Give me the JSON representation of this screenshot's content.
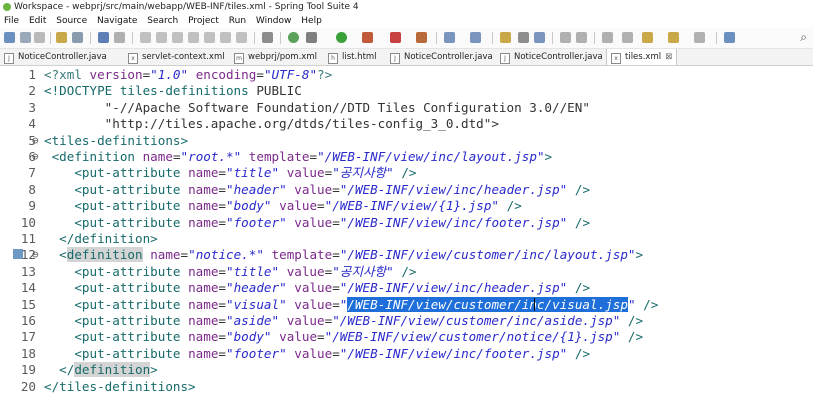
{
  "window": {
    "title": "Workspace - webprj/src/main/webapp/WEB-INF/tiles.xml - Spring Tool Suite 4"
  },
  "menu": [
    "File",
    "Edit",
    "Source",
    "Navigate",
    "Search",
    "Project",
    "Run",
    "Window",
    "Help"
  ],
  "tabs": [
    {
      "label": "NoticeController.java",
      "active": false
    },
    {
      "label": "servlet-context.xml",
      "active": false
    },
    {
      "label": "webprj/pom.xml",
      "active": false
    },
    {
      "label": "list.html",
      "active": false
    },
    {
      "label": "NoticeController.java",
      "active": false
    },
    {
      "label": "NoticeController.java",
      "active": false
    },
    {
      "label": "tiles.xml",
      "active": true
    }
  ],
  "editor": {
    "lines": [
      {
        "n": "1",
        "fold": "",
        "segs": [
          [
            "pi",
            "<?xml "
          ],
          [
            "attr",
            "version"
          ],
          [
            "plain",
            "="
          ],
          [
            "val",
            "\"1.0\""
          ],
          [
            "plain",
            " "
          ],
          [
            "attr",
            "encoding"
          ],
          [
            "plain",
            "="
          ],
          [
            "val",
            "\"UTF-8\""
          ],
          [
            "pi",
            "?>"
          ]
        ]
      },
      {
        "n": "2",
        "fold": "",
        "segs": [
          [
            "tag",
            "<!DOCTYPE "
          ],
          [
            "kw",
            "tiles-definitions "
          ],
          [
            "doc",
            "PUBLIC"
          ]
        ]
      },
      {
        "n": "3",
        "fold": "",
        "segs": [
          [
            "doc",
            "        \"-//Apache Software Foundation//DTD Tiles Configuration 3.0//EN\""
          ]
        ]
      },
      {
        "n": "4",
        "fold": "",
        "segs": [
          [
            "doc",
            "        \"http://tiles.apache.org/dtds/tiles-config_3_0.dtd\">"
          ]
        ]
      },
      {
        "n": "5",
        "fold": "⊖",
        "segs": [
          [
            "tag",
            "<tiles-definitions>"
          ]
        ]
      },
      {
        "n": "6",
        "fold": "⊖",
        "segs": [
          [
            "plain",
            " "
          ],
          [
            "tag",
            "<definition "
          ],
          [
            "attr",
            "name"
          ],
          [
            "plain",
            "="
          ],
          [
            "val",
            "\"root.*\""
          ],
          [
            "plain",
            " "
          ],
          [
            "attr",
            "template"
          ],
          [
            "plain",
            "="
          ],
          [
            "val",
            "\"/WEB-INF/view/inc/layout.jsp\""
          ],
          [
            "tag",
            ">"
          ]
        ]
      },
      {
        "n": "7",
        "fold": "",
        "segs": [
          [
            "plain",
            "    "
          ],
          [
            "tag",
            "<put-attribute "
          ],
          [
            "attr",
            "name"
          ],
          [
            "plain",
            "="
          ],
          [
            "val",
            "\"title\""
          ],
          [
            "plain",
            " "
          ],
          [
            "attr",
            "value"
          ],
          [
            "plain",
            "="
          ],
          [
            "val",
            "\"공지사항\""
          ],
          [
            "plain",
            " "
          ],
          [
            "tag",
            "/>"
          ]
        ]
      },
      {
        "n": "8",
        "fold": "",
        "segs": [
          [
            "plain",
            "    "
          ],
          [
            "tag",
            "<put-attribute "
          ],
          [
            "attr",
            "name"
          ],
          [
            "plain",
            "="
          ],
          [
            "val",
            "\"header\""
          ],
          [
            "plain",
            " "
          ],
          [
            "attr",
            "value"
          ],
          [
            "plain",
            "="
          ],
          [
            "val",
            "\"/WEB-INF/view/inc/header.jsp\""
          ],
          [
            "plain",
            " "
          ],
          [
            "tag",
            "/>"
          ]
        ]
      },
      {
        "n": "9",
        "fold": "",
        "segs": [
          [
            "plain",
            "    "
          ],
          [
            "tag",
            "<put-attribute "
          ],
          [
            "attr",
            "name"
          ],
          [
            "plain",
            "="
          ],
          [
            "val",
            "\"body\""
          ],
          [
            "plain",
            " "
          ],
          [
            "attr",
            "value"
          ],
          [
            "plain",
            "="
          ],
          [
            "val",
            "\"/WEB-INF/view/{1}.jsp\""
          ],
          [
            "plain",
            " "
          ],
          [
            "tag",
            "/>"
          ]
        ]
      },
      {
        "n": "10",
        "fold": "",
        "segs": [
          [
            "plain",
            "    "
          ],
          [
            "tag",
            "<put-attribute "
          ],
          [
            "attr",
            "name"
          ],
          [
            "plain",
            "="
          ],
          [
            "val",
            "\"footer\""
          ],
          [
            "plain",
            " "
          ],
          [
            "attr",
            "value"
          ],
          [
            "plain",
            "="
          ],
          [
            "val",
            "\"/WEB-INF/view/inc/footer.jsp\""
          ],
          [
            "plain",
            " "
          ],
          [
            "tag",
            "/>"
          ]
        ]
      },
      {
        "n": "11",
        "fold": "",
        "segs": [
          [
            "plain",
            "  "
          ],
          [
            "tag",
            "</definition>"
          ]
        ]
      },
      {
        "n": "12",
        "fold": "⊖",
        "segs": [
          [
            "plain",
            "  "
          ],
          [
            "tag",
            "<"
          ],
          [
            "hl",
            "definition"
          ],
          [
            "plain",
            " "
          ],
          [
            "attr",
            "name"
          ],
          [
            "plain",
            "="
          ],
          [
            "val",
            "\"notice.*\""
          ],
          [
            "plain",
            " "
          ],
          [
            "attr",
            "template"
          ],
          [
            "plain",
            "="
          ],
          [
            "val",
            "\"/WEB-INF/view/customer/inc/layout.jsp\""
          ],
          [
            "tag",
            ">"
          ]
        ]
      },
      {
        "n": "13",
        "fold": "",
        "segs": [
          [
            "plain",
            "    "
          ],
          [
            "tag",
            "<put-attribute "
          ],
          [
            "attr",
            "name"
          ],
          [
            "plain",
            "="
          ],
          [
            "val",
            "\"title\""
          ],
          [
            "plain",
            " "
          ],
          [
            "attr",
            "value"
          ],
          [
            "plain",
            "="
          ],
          [
            "val",
            "\"공지사항\""
          ],
          [
            "plain",
            " "
          ],
          [
            "tag",
            "/>"
          ]
        ]
      },
      {
        "n": "14",
        "fold": "",
        "segs": [
          [
            "plain",
            "    "
          ],
          [
            "tag",
            "<put-attribute "
          ],
          [
            "attr",
            "name"
          ],
          [
            "plain",
            "="
          ],
          [
            "val",
            "\"header\""
          ],
          [
            "plain",
            " "
          ],
          [
            "attr",
            "value"
          ],
          [
            "plain",
            "="
          ],
          [
            "val",
            "\"/WEB-INF/view/inc/header.jsp\""
          ],
          [
            "plain",
            " "
          ],
          [
            "tag",
            "/>"
          ]
        ]
      },
      {
        "n": "15",
        "fold": "",
        "segs": [
          [
            "plain",
            "    "
          ],
          [
            "tag",
            "<put-attribute "
          ],
          [
            "attr",
            "name"
          ],
          [
            "plain",
            "="
          ],
          [
            "val",
            "\"visual\""
          ],
          [
            "plain",
            " "
          ],
          [
            "attr",
            "value"
          ],
          [
            "plain",
            "="
          ],
          [
            "val",
            "\""
          ],
          [
            "sel",
            "/WEB-INF/view/customer/inc/visual.jsp"
          ],
          [
            "val",
            "\""
          ],
          [
            "plain",
            " "
          ],
          [
            "tag",
            "/>"
          ]
        ]
      },
      {
        "n": "16",
        "fold": "",
        "segs": [
          [
            "plain",
            "    "
          ],
          [
            "tag",
            "<put-attribute "
          ],
          [
            "attr",
            "name"
          ],
          [
            "plain",
            "="
          ],
          [
            "val",
            "\"aside\""
          ],
          [
            "plain",
            " "
          ],
          [
            "attr",
            "value"
          ],
          [
            "plain",
            "="
          ],
          [
            "val",
            "\"/WEB-INF/view/customer/inc/aside.jsp\""
          ],
          [
            "plain",
            " "
          ],
          [
            "tag",
            "/>"
          ]
        ]
      },
      {
        "n": "17",
        "fold": "",
        "segs": [
          [
            "plain",
            "    "
          ],
          [
            "tag",
            "<put-attribute "
          ],
          [
            "attr",
            "name"
          ],
          [
            "plain",
            "="
          ],
          [
            "val",
            "\"body\""
          ],
          [
            "plain",
            " "
          ],
          [
            "attr",
            "value"
          ],
          [
            "plain",
            "="
          ],
          [
            "val",
            "\"/WEB-INF/view/customer/notice/{1}.jsp\""
          ],
          [
            "plain",
            " "
          ],
          [
            "tag",
            "/>"
          ]
        ]
      },
      {
        "n": "18",
        "fold": "",
        "segs": [
          [
            "plain",
            "    "
          ],
          [
            "tag",
            "<put-attribute "
          ],
          [
            "attr",
            "name"
          ],
          [
            "plain",
            "="
          ],
          [
            "val",
            "\"footer\""
          ],
          [
            "plain",
            " "
          ],
          [
            "attr",
            "value"
          ],
          [
            "plain",
            "="
          ],
          [
            "val",
            "\"/WEB-INF/view/inc/footer.jsp\""
          ],
          [
            "plain",
            " "
          ],
          [
            "tag",
            "/>"
          ]
        ]
      },
      {
        "n": "19",
        "fold": "",
        "segs": [
          [
            "plain",
            "  "
          ],
          [
            "tag",
            "</"
          ],
          [
            "hl",
            "definition"
          ],
          [
            "tag",
            ">"
          ]
        ]
      },
      {
        "n": "20",
        "fold": "",
        "segs": [
          [
            "tag",
            "</tiles-definitions>"
          ]
        ]
      }
    ]
  }
}
